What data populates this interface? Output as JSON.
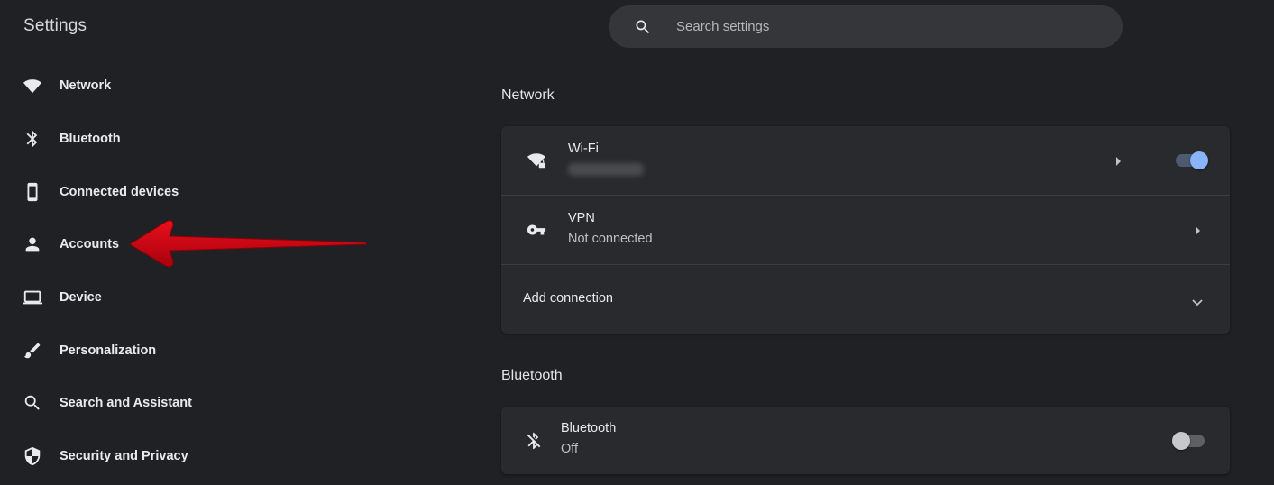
{
  "app": {
    "title": "Settings"
  },
  "search": {
    "placeholder": "Search settings",
    "value": ""
  },
  "sidebar": {
    "items": [
      {
        "label": "Network",
        "icon": "wifi-icon"
      },
      {
        "label": "Bluetooth",
        "icon": "bluetooth-icon"
      },
      {
        "label": "Connected devices",
        "icon": "phone-icon"
      },
      {
        "label": "Accounts",
        "icon": "person-icon"
      },
      {
        "label": "Device",
        "icon": "laptop-icon"
      },
      {
        "label": "Personalization",
        "icon": "brush-icon"
      },
      {
        "label": "Search and Assistant",
        "icon": "search-icon"
      },
      {
        "label": "Security and Privacy",
        "icon": "shield-icon"
      }
    ]
  },
  "network": {
    "section_title": "Network",
    "wifi": {
      "label": "Wi-Fi",
      "network_name_hidden": true,
      "enabled": true
    },
    "vpn": {
      "label": "VPN",
      "status": "Not connected"
    },
    "add_connection": {
      "label": "Add connection"
    }
  },
  "bluetooth": {
    "section_title": "Bluetooth",
    "label": "Bluetooth",
    "status": "Off",
    "enabled": false
  },
  "annotation": {
    "type": "red-arrow",
    "points_to": "Accounts",
    "color": "#d0021b"
  },
  "colors": {
    "background": "#202124",
    "card": "#292a2d",
    "accent": "#8ab4f8"
  }
}
